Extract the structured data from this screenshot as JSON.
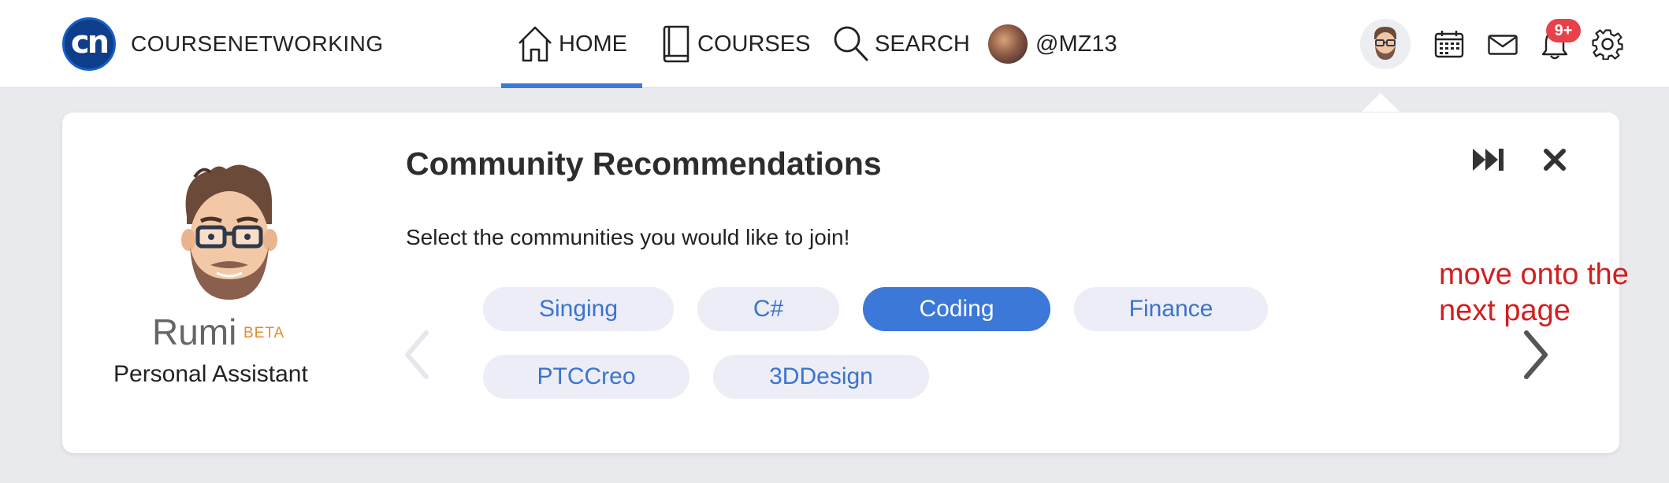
{
  "brand": {
    "logo_text": "cn",
    "name": "COURSENETWORKING"
  },
  "nav": {
    "home": {
      "label": "HOME",
      "icon": "home-icon",
      "active": true
    },
    "courses": {
      "label": "COURSES",
      "icon": "book-icon"
    },
    "search": {
      "label": "SEARCH",
      "icon": "search-icon"
    },
    "profile": {
      "label": "@MZ13",
      "icon": "avatar"
    }
  },
  "right_icons": {
    "avatar": "user-avatar",
    "calendar": "calendar-icon",
    "mail": "mail-icon",
    "notifications": {
      "icon": "bell-icon",
      "badge": "9+"
    },
    "settings": "gear-icon"
  },
  "assistant": {
    "name": "Rumi",
    "tag": "BETA",
    "role": "Personal Assistant"
  },
  "recommendations": {
    "title": "Community Recommendations",
    "subtitle": "Select the communities you would like to join!",
    "communities": [
      {
        "label": "Singing",
        "selected": false
      },
      {
        "label": "C#",
        "selected": false
      },
      {
        "label": "Coding",
        "selected": true
      },
      {
        "label": "Finance",
        "selected": false
      },
      {
        "label": "PTCCreo",
        "selected": false
      },
      {
        "label": "3DDesign",
        "selected": false
      }
    ]
  },
  "annotation": {
    "text": "move onto the next page"
  },
  "colors": {
    "accent": "#3b78d8",
    "pill_bg": "#ecedf6",
    "badge": "#e8414a",
    "annotation": "#d21f1f",
    "beta": "#e58a2b"
  }
}
